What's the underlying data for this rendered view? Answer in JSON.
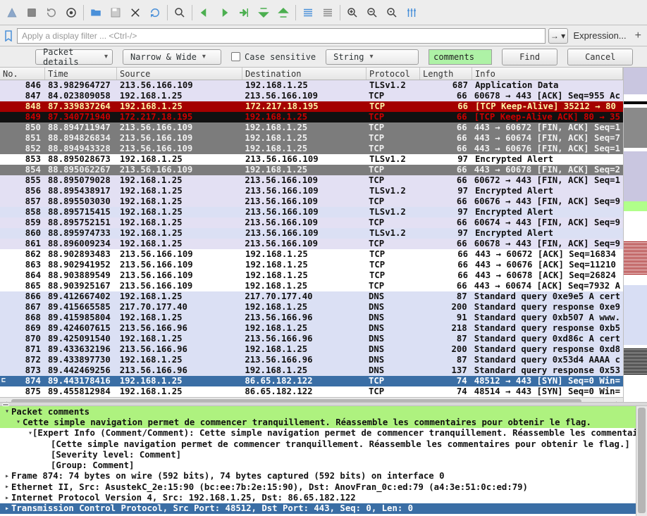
{
  "toolbar_icons": [
    "capture-start",
    "capture-stop",
    "capture-restart",
    "capture-options",
    "sep",
    "open",
    "save",
    "close",
    "reload",
    "sep",
    "find",
    "sep",
    "go-back",
    "go-forward",
    "go-to-packet",
    "go-first",
    "go-last",
    "sep",
    "autoscroll",
    "colorize",
    "sep",
    "zoom-in",
    "zoom-out",
    "zoom-reset",
    "resize-columns"
  ],
  "display_filter_placeholder": "Apply a display filter ... <Ctrl-/>",
  "expression_label": "Expression...",
  "findbar": {
    "scope": "Packet details",
    "char": "Narrow & Wide",
    "case_label": "Case sensitive",
    "type": "String",
    "value": "comments",
    "find_btn": "Find",
    "cancel_btn": "Cancel"
  },
  "columns": {
    "no": "No.",
    "time": "Time",
    "src": "Source",
    "dst": "Destination",
    "proto": "Protocol",
    "len": "Length",
    "info": "Info"
  },
  "rows": [
    {
      "cls": "bg-lav",
      "no": "846",
      "t": "83.982964727",
      "s": "213.56.166.109",
      "d": "192.168.1.25",
      "p": "TLSv1.2",
      "l": "687",
      "i": "Application Data"
    },
    {
      "cls": "bg-lav",
      "no": "847",
      "t": "84.023809058",
      "s": "192.168.1.25",
      "d": "213.56.166.109",
      "p": "TCP",
      "l": "66",
      "i": "60678 → 443 [ACK] Seq=955 Ac"
    },
    {
      "cls": "bg-red",
      "no": "848",
      "t": "87.339837264",
      "s": "192.168.1.25",
      "d": "172.217.18.195",
      "p": "TCP",
      "l": "66",
      "i": "[TCP Keep-Alive] 35212 → 80"
    },
    {
      "cls": "bg-black",
      "no": "849",
      "t": "87.340771940",
      "s": "172.217.18.195",
      "d": "192.168.1.25",
      "p": "TCP",
      "l": "66",
      "i": "[TCP Keep-Alive ACK] 80 → 35"
    },
    {
      "cls": "bg-grey",
      "no": "850",
      "t": "88.894711947",
      "s": "213.56.166.109",
      "d": "192.168.1.25",
      "p": "TCP",
      "l": "66",
      "i": "443 → 60672 [FIN, ACK] Seq=1"
    },
    {
      "cls": "bg-grey",
      "no": "851",
      "t": "88.894826834",
      "s": "213.56.166.109",
      "d": "192.168.1.25",
      "p": "TCP",
      "l": "66",
      "i": "443 → 60674 [FIN, ACK] Seq=7"
    },
    {
      "cls": "bg-grey",
      "no": "852",
      "t": "88.894943328",
      "s": "213.56.166.109",
      "d": "192.168.1.25",
      "p": "TCP",
      "l": "66",
      "i": "443 → 60676 [FIN, ACK] Seq=1"
    },
    {
      "cls": "bg-white",
      "no": "853",
      "t": "88.895028673",
      "s": "192.168.1.25",
      "d": "213.56.166.109",
      "p": "TLSv1.2",
      "l": "97",
      "i": "Encrypted Alert"
    },
    {
      "cls": "bg-grey",
      "no": "854",
      "t": "88.895062267",
      "s": "213.56.166.109",
      "d": "192.168.1.25",
      "p": "TCP",
      "l": "66",
      "i": "443 → 60678 [FIN, ACK] Seq=2"
    },
    {
      "cls": "bg-lav",
      "no": "855",
      "t": "88.895079028",
      "s": "192.168.1.25",
      "d": "213.56.166.109",
      "p": "TCP",
      "l": "66",
      "i": "60672 → 443 [FIN, ACK] Seq=1"
    },
    {
      "cls": "bg-lav",
      "no": "856",
      "t": "88.895438917",
      "s": "192.168.1.25",
      "d": "213.56.166.109",
      "p": "TLSv1.2",
      "l": "97",
      "i": "Encrypted Alert"
    },
    {
      "cls": "bg-lav",
      "no": "857",
      "t": "88.895503030",
      "s": "192.168.1.25",
      "d": "213.56.166.109",
      "p": "TCP",
      "l": "66",
      "i": "60676 → 443 [FIN, ACK] Seq=9"
    },
    {
      "cls": "bg-lil",
      "no": "858",
      "t": "88.895715415",
      "s": "192.168.1.25",
      "d": "213.56.166.109",
      "p": "TLSv1.2",
      "l": "97",
      "i": "Encrypted Alert"
    },
    {
      "cls": "bg-lav",
      "no": "859",
      "t": "88.895752151",
      "s": "192.168.1.25",
      "d": "213.56.166.109",
      "p": "TCP",
      "l": "66",
      "i": "60674 → 443 [FIN, ACK] Seq=9"
    },
    {
      "cls": "bg-lil",
      "no": "860",
      "t": "88.895974733",
      "s": "192.168.1.25",
      "d": "213.56.166.109",
      "p": "TLSv1.2",
      "l": "97",
      "i": "Encrypted Alert"
    },
    {
      "cls": "bg-lav",
      "no": "861",
      "t": "88.896009234",
      "s": "192.168.1.25",
      "d": "213.56.166.109",
      "p": "TCP",
      "l": "66",
      "i": "60678 → 443 [FIN, ACK] Seq=9"
    },
    {
      "cls": "bg-white",
      "no": "862",
      "t": "88.902893483",
      "s": "213.56.166.109",
      "d": "192.168.1.25",
      "p": "TCP",
      "l": "66",
      "i": "443 → 60672 [ACK] Seq=16834"
    },
    {
      "cls": "bg-white",
      "no": "863",
      "t": "88.902941952",
      "s": "213.56.166.109",
      "d": "192.168.1.25",
      "p": "TCP",
      "l": "66",
      "i": "443 → 60676 [ACK] Seq=11210"
    },
    {
      "cls": "bg-white",
      "no": "864",
      "t": "88.903889549",
      "s": "213.56.166.109",
      "d": "192.168.1.25",
      "p": "TCP",
      "l": "66",
      "i": "443 → 60678 [ACK] Seq=26824"
    },
    {
      "cls": "bg-white",
      "no": "865",
      "t": "88.903925167",
      "s": "213.56.166.109",
      "d": "192.168.1.25",
      "p": "TCP",
      "l": "66",
      "i": "443 → 60674 [ACK] Seq=7932 A"
    },
    {
      "cls": "bg-lil",
      "no": "866",
      "t": "89.412667402",
      "s": "192.168.1.25",
      "d": "217.70.177.40",
      "p": "DNS",
      "l": "87",
      "i": "Standard query 0xe9e5 A cert"
    },
    {
      "cls": "bg-lil",
      "no": "867",
      "t": "89.415665585",
      "s": "217.70.177.40",
      "d": "192.168.1.25",
      "p": "DNS",
      "l": "200",
      "i": "Standard query response 0xe9"
    },
    {
      "cls": "bg-lil",
      "no": "868",
      "t": "89.415985804",
      "s": "192.168.1.25",
      "d": "213.56.166.96",
      "p": "DNS",
      "l": "91",
      "i": "Standard query 0xb507 A www."
    },
    {
      "cls": "bg-lil",
      "no": "869",
      "t": "89.424607615",
      "s": "213.56.166.96",
      "d": "192.168.1.25",
      "p": "DNS",
      "l": "218",
      "i": "Standard query response 0xb5"
    },
    {
      "cls": "bg-lil",
      "no": "870",
      "t": "89.425091540",
      "s": "192.168.1.25",
      "d": "213.56.166.96",
      "p": "DNS",
      "l": "87",
      "i": "Standard query 0xd86c A cert"
    },
    {
      "cls": "bg-lil",
      "no": "871",
      "t": "89.433632196",
      "s": "213.56.166.96",
      "d": "192.168.1.25",
      "p": "DNS",
      "l": "200",
      "i": "Standard query response 0xd8"
    },
    {
      "cls": "bg-lil",
      "no": "872",
      "t": "89.433897730",
      "s": "192.168.1.25",
      "d": "213.56.166.96",
      "p": "DNS",
      "l": "87",
      "i": "Standard query 0x53d4 AAAA c"
    },
    {
      "cls": "bg-lil",
      "no": "873",
      "t": "89.442469256",
      "s": "213.56.166.96",
      "d": "192.168.1.25",
      "p": "DNS",
      "l": "137",
      "i": "Standard query response 0x53"
    },
    {
      "cls": "bg-sel",
      "no": "874",
      "t": "89.443178416",
      "s": "192.168.1.25",
      "d": "86.65.182.122",
      "p": "TCP",
      "l": "74",
      "i": "48512 → 443 [SYN] Seq=0 Win="
    },
    {
      "cls": "bg-white",
      "no": "875",
      "t": "89.455812984",
      "s": "192.168.1.25",
      "d": "86.65.182.122",
      "p": "TCP",
      "l": "74",
      "i": "48514 → 443 [SYN] Seq=0 Win="
    }
  ],
  "details": {
    "packet_comments": "Packet comments",
    "comment_text": "Cette simple navigation permet de commencer tranquillement. Réassemble les commentaires pour obtenir le flag.",
    "expert_info": "[Expert Info (Comment/Comment): Cette simple navigation permet de commencer tranquillement. Réassemble les commentai",
    "expert_info2": "[Cette simple navigation permet de commencer tranquillement. Réassemble les commentaires pour obtenir le flag.]",
    "severity": "[Severity level: Comment]",
    "group": "[Group: Comment]",
    "frame": "Frame 874: 74 bytes on wire (592 bits), 74 bytes captured (592 bits) on interface 0",
    "eth": "Ethernet II, Src: AsustekC_2e:15:90 (bc:ee:7b:2e:15:90), Dst: AnovFran_0c:ed:79 (a4:3e:51:0c:ed:79)",
    "ip": "Internet Protocol Version 4, Src: 192.168.1.25, Dst: 86.65.182.122",
    "tcp": "Transmission Control Protocol, Src Port: 48512, Dst Port: 443, Seq: 0, Len: 0"
  }
}
